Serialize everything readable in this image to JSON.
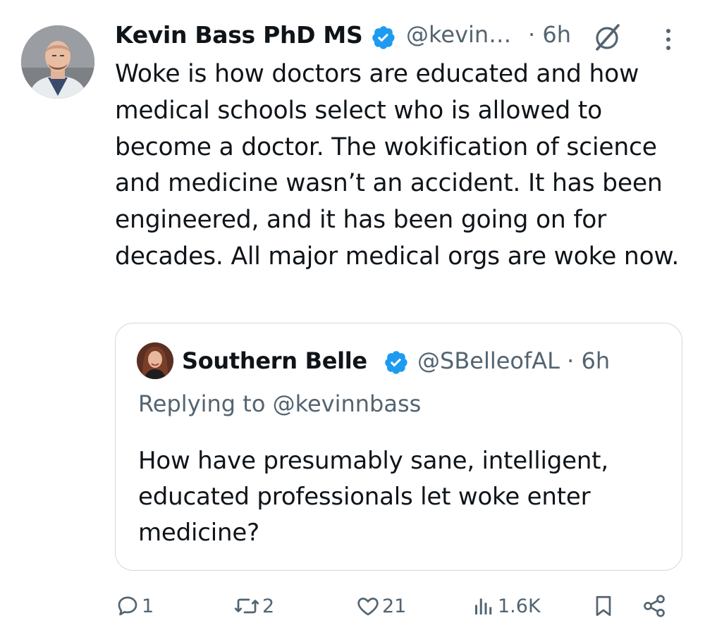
{
  "tweet": {
    "author_name": "Kevin Bass PhD MS",
    "handle": "@kevin…",
    "time": "· 6h",
    "text": "Woke is how doctors are educated and how medical schools select who is allowed to become a doctor. The wokification of science and medicine wasn’t an accident. It has been engineered, and it has been going on for decades. All major medical orgs are woke now."
  },
  "quote": {
    "author_name": "Southern Belle",
    "handle_time": "@SBelleofAL · 6h",
    "replying_to": "Replying to @kevinnbass",
    "text": "How have presumably sane, intelligent, educated professionals let woke enter medicine?"
  },
  "actions": {
    "replies": "1",
    "reposts": "2",
    "likes": "21",
    "views": "1.6K"
  },
  "colors": {
    "verified": "#1d9bf0",
    "secondary_text": "#536471",
    "border": "#cfd9de"
  },
  "icons": [
    "verified-badge-icon",
    "grok-icon",
    "more-vertical-icon",
    "reply-icon",
    "repost-icon",
    "like-icon",
    "views-icon",
    "bookmark-icon",
    "share-icon"
  ]
}
